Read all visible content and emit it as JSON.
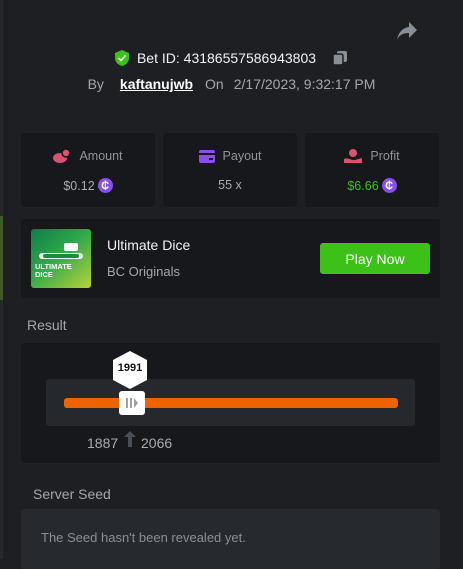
{
  "header": {
    "bet_id_label": "Bet ID: 43186557586943803",
    "by_label": "By",
    "username": "kaftanujwb",
    "on_label": "On",
    "datetime": "2/17/2023, 9:32:17 PM"
  },
  "stats": [
    {
      "label": "Amount",
      "value": "$0.12",
      "icon": "amount-icon",
      "color": "#e0516f"
    },
    {
      "label": "Payout",
      "value": "55 x",
      "icon": "wallet-icon",
      "color": "#8a4fe8"
    },
    {
      "label": "Profit",
      "value": "$6.66",
      "icon": "profit-icon",
      "color": "#e0516f"
    }
  ],
  "currency_symbol": "₵",
  "game": {
    "title": "Ultimate Dice",
    "provider": "BC Originals",
    "thumbnail_text": "ULTIMATE DICE",
    "play_label": "Play Now"
  },
  "result": {
    "label": "Result",
    "value": "1991",
    "range_min": "1887",
    "range_max": "2066"
  },
  "server_seed": {
    "label": "Server Seed",
    "message": "The Seed hasn't been revealed yet."
  },
  "colors": {
    "accent_green": "#3bc117",
    "accent_orange": "#ed6300",
    "coin_purple": "#8a4fe8",
    "background": "#1d1f22",
    "panel": "#16181b"
  }
}
